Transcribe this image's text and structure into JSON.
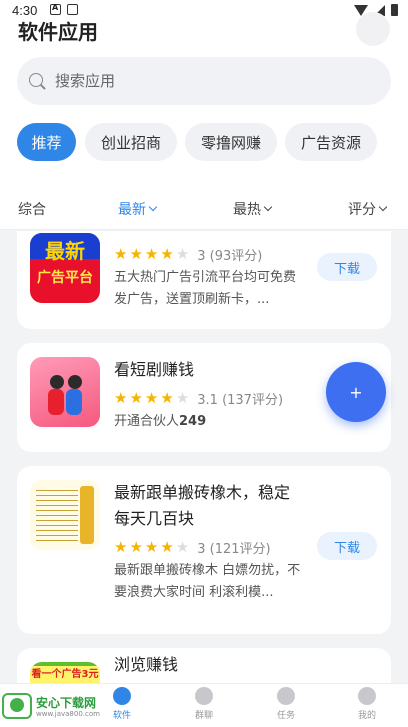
{
  "status": {
    "time": "4:30"
  },
  "header": {
    "title": "软件应用"
  },
  "search": {
    "placeholder": "搜索应用"
  },
  "categories": [
    "推荐",
    "创业招商",
    "零撸网赚",
    "广告资源"
  ],
  "sort": {
    "tabs": [
      "综合",
      "最新",
      "最热",
      "评分"
    ],
    "active": "最新"
  },
  "apps": [
    {
      "name": "",
      "icon_text": [
        "最新",
        "广告平台"
      ],
      "rating": 3,
      "rating_text": "3 (93评分)",
      "desc": "五大热门广告引流平台均可免费发广告，送置顶刷新卡，...",
      "button": "下载"
    },
    {
      "name": "看短剧赚钱",
      "rating": 3.1,
      "rating_text": "3.1 (137评分)",
      "desc_prefix": "开通合伙人",
      "desc_num": "249"
    },
    {
      "name": "最新跟单搬砖橡木，稳定每天几百块",
      "rating": 3,
      "rating_text": "3 (121评分)",
      "desc": "最新跟单搬砖橡木 白嫖勿扰，不要浪费大家时间 利滚利模...",
      "button": "下载"
    },
    {
      "name": "浏览赚钱",
      "icon_text": "看一个广告3元"
    }
  ],
  "fab": {
    "label": "+"
  },
  "nav": [
    {
      "label": "软件"
    },
    {
      "label": "群聊"
    },
    {
      "label": "任务"
    },
    {
      "label": "我的"
    }
  ],
  "watermark": {
    "brand": "安心下载网",
    "url": "www.java800.com"
  },
  "colors": {
    "accent": "#2f86e6",
    "star": "#f4b400",
    "fab": "#3e6ff0"
  }
}
